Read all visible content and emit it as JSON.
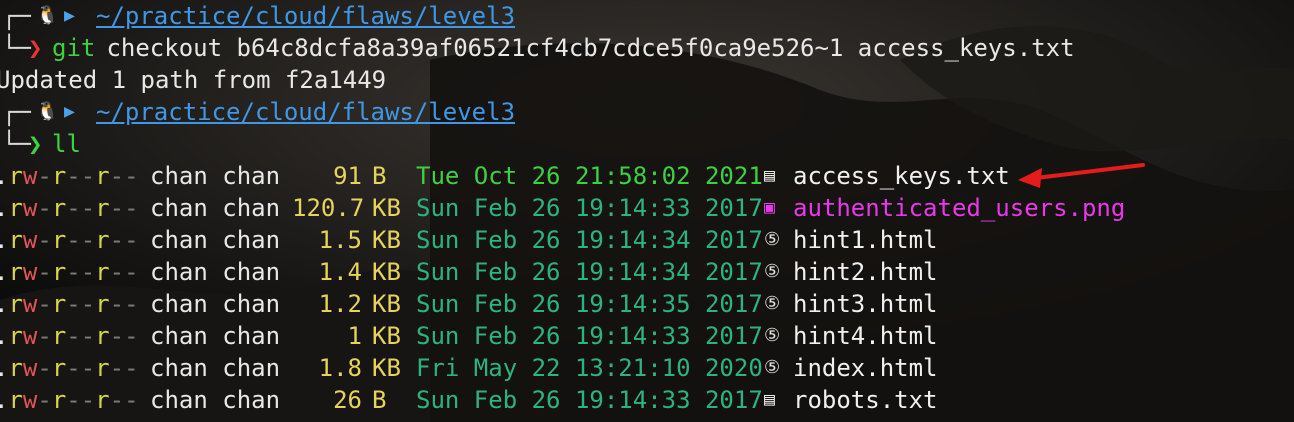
{
  "prompt": {
    "corner_top": "┌─",
    "corner_bottom": "└─",
    "os_icon": "🐧",
    "folder_icon": "▶",
    "path": "~/practice/cloud/flaws/level3",
    "chevron": "❯"
  },
  "commands": [
    {
      "verb": "git",
      "args": " checkout b64c8dcfa8a39af06521cf4cb7cdce5f0ca9e526~1 access_keys.txt"
    },
    {
      "verb": "ll",
      "args": ""
    }
  ],
  "output_line": "Updated 1 path from f2a1449",
  "listing": [
    {
      "perm": ".rw-r--r--",
      "owner": "chan chan",
      "size": "91",
      "unit": "B",
      "date": "Tue Oct 26 21:58:02 2021",
      "recent": true,
      "icon": "file-text-icon",
      "glyph": "▤",
      "name": "access_keys.txt",
      "type": "text"
    },
    {
      "perm": ".rw-r--r--",
      "owner": "chan chan",
      "size": "120.7",
      "unit": "KB",
      "date": "Sun Feb 26 19:14:33 2017",
      "recent": false,
      "icon": "image-file-icon",
      "glyph": "▣",
      "name": "authenticated_users.png",
      "type": "image"
    },
    {
      "perm": ".rw-r--r--",
      "owner": "chan chan",
      "size": "1.5",
      "unit": "KB",
      "date": "Sun Feb 26 19:14:34 2017",
      "recent": false,
      "icon": "html5-icon",
      "glyph": "⑤",
      "name": "hint1.html",
      "type": "html"
    },
    {
      "perm": ".rw-r--r--",
      "owner": "chan chan",
      "size": "1.4",
      "unit": "KB",
      "date": "Sun Feb 26 19:14:34 2017",
      "recent": false,
      "icon": "html5-icon",
      "glyph": "⑤",
      "name": "hint2.html",
      "type": "html"
    },
    {
      "perm": ".rw-r--r--",
      "owner": "chan chan",
      "size": "1.2",
      "unit": "KB",
      "date": "Sun Feb 26 19:14:35 2017",
      "recent": false,
      "icon": "html5-icon",
      "glyph": "⑤",
      "name": "hint3.html",
      "type": "html"
    },
    {
      "perm": ".rw-r--r--",
      "owner": "chan chan",
      "size": "1",
      "unit": "KB",
      "date": "Sun Feb 26 19:14:33 2017",
      "recent": false,
      "icon": "html5-icon",
      "glyph": "⑤",
      "name": "hint4.html",
      "type": "html"
    },
    {
      "perm": ".rw-r--r--",
      "owner": "chan chan",
      "size": "1.8",
      "unit": "KB",
      "date": "Fri May 22 13:21:10 2020",
      "recent": false,
      "icon": "html5-icon",
      "glyph": "⑤",
      "name": "index.html",
      "type": "html"
    },
    {
      "perm": ".rw-r--r--",
      "owner": "chan chan",
      "size": "26",
      "unit": "B",
      "date": "Sun Feb 26 19:14:33 2017",
      "recent": false,
      "icon": "file-text-icon",
      "glyph": "▤",
      "name": "robots.txt",
      "type": "text"
    }
  ],
  "colors": {
    "background": "#0d0d0d",
    "path": "#3f97e6",
    "command": "#3ed13e",
    "error_chevron": "#e53535",
    "success_chevron": "#3ed13e",
    "annotation_arrow": "#e51c1c",
    "image_file": "#e838e8"
  }
}
